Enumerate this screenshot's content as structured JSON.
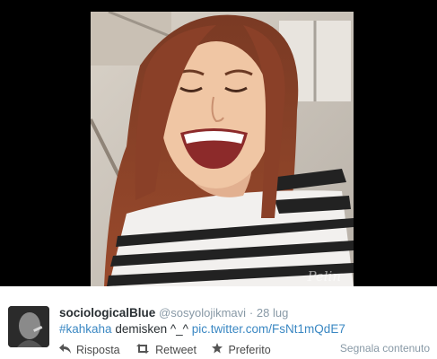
{
  "media": {
    "watermark": "Pelin"
  },
  "tweet": {
    "fullname": "sociologicalBlue",
    "username": "@sosyolojikmavi",
    "separator": "·",
    "time": "28 lug",
    "hashtag": "#kahkaha",
    "text": " demisken ^_^ ",
    "link": "pic.twitter.com/FsNt1mQdE7"
  },
  "actions": {
    "reply_label": "Risposta",
    "retweet_label": "Retweet",
    "favorite_label": "Preferito",
    "report_label": "Segnala contenuto",
    "reply_icon": "reply-icon",
    "retweet_icon": "retweet-icon",
    "favorite_icon": "star-icon"
  },
  "colors": {
    "link": "#3b88c3",
    "name": "#292f33",
    "meta": "#8899a6",
    "media_background": "#000000"
  }
}
